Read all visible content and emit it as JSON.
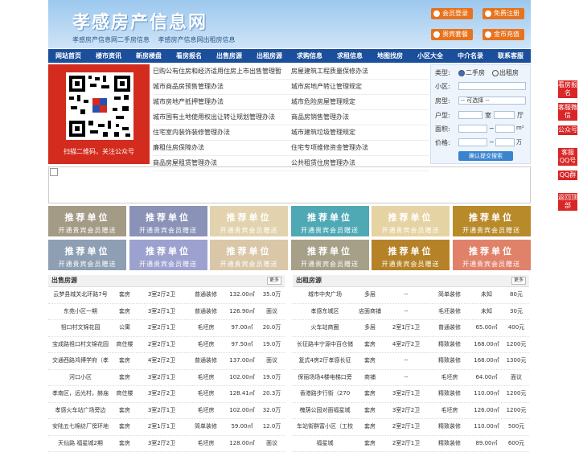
{
  "header": {
    "logo": "孝感房产信息网",
    "subtitle_1": "孝感房产信息网二手房信息",
    "subtitle_2": "孝感房产信息网出租房信息",
    "buttons": [
      "会员登录",
      "免费注册",
      "贵宾套餐",
      "金币充值"
    ]
  },
  "nav": [
    "网站首页",
    "楼市资讯",
    "新房楼盘",
    "看房报名",
    "出售房源",
    "出租房源",
    "求购信息",
    "求租信息",
    "地图找房",
    "小区大全",
    "中介名录",
    "联系客服"
  ],
  "qr": {
    "caption": "扫描二维码，关注公众号"
  },
  "links": [
    [
      "已购公有住房和经济适用住房上市出售管理暂",
      "房屋建筑工程质量保修办法"
    ],
    [
      "城市商品房预售管理办法",
      "城市房地产转让管理规定"
    ],
    [
      "城市房地产抵押管理办法",
      "城市危险房屋管理规定"
    ],
    [
      "城市国有土地使用权出让转让规划管理办法",
      "商品房销售管理办法"
    ],
    [
      "住宅室内装饰装修管理办法",
      "城市建筑垃圾管理规定"
    ],
    [
      "廉租住房保障办法",
      "住宅专项维修资金管理办法"
    ],
    [
      "商品房屋租赁管理办法",
      "公共租赁住房管理办法"
    ]
  ],
  "search": {
    "type_label": "类型:",
    "option_sale": "二手房",
    "option_rent": "出租房",
    "community_label": "小区:",
    "house_type_label": "房型:",
    "house_type_value": "-- 可选择 --",
    "layout_label": "户型:",
    "room_unit": "室",
    "hall_unit": "厅",
    "area_label": "面积:",
    "area_unit": "m²",
    "price_label": "价格:",
    "price_unit": "万",
    "range_sep": "~",
    "submit": "确认提交搜索"
  },
  "tiles": {
    "title": "推荐单位",
    "subtitle": "开通贵宾会员赠送"
  },
  "sale": {
    "title": "出售房源",
    "more": "更多",
    "rows": [
      [
        "云梦县城关北环路7号",
        "套房",
        "3室2厅2卫",
        "普通装修",
        "132.00㎡",
        "35.0万"
      ],
      [
        "东苑小区一期",
        "套房",
        "3室2厅1卫",
        "普通装修",
        "126.90㎡",
        "面议"
      ],
      [
        "祖口村文锦花园",
        "公寓",
        "2室2厅1卫",
        "毛坯房",
        "97.00㎡",
        "20.0万"
      ],
      [
        "宝成路祖口村文锦花园",
        "商住楼",
        "2室2厅1卫",
        "毛坯房",
        "97.50㎡",
        "19.0万"
      ],
      [
        "交通西路鸿博学府（孝",
        "套房",
        "4室2厅2卫",
        "普通装修",
        "137.00㎡",
        "面议"
      ],
      [
        "河口小区",
        "套房",
        "3室2厅1卫",
        "毛坯房",
        "102.00㎡",
        "19.0万"
      ],
      [
        "孝南区，远光村，赫庙",
        "商住楼",
        "3室2厅2卫",
        "毛坯房",
        "128.41㎡",
        "20.3万"
      ],
      [
        "孝感火车站广场旁边",
        "套房",
        "3室2厅1卫",
        "毛坯房",
        "102.00㎡",
        "32.0万"
      ],
      [
        "安陆五七棉纺厂傍环地",
        "套房",
        "2室1厅1卫",
        "简单装修",
        "59.00㎡",
        "12.0万"
      ],
      [
        "天仙路 福星城2期",
        "套房",
        "3室2厅2卫",
        "毛坯房",
        "128.00㎡",
        "面议"
      ]
    ]
  },
  "rent": {
    "title": "出租房源",
    "more": "更多",
    "rows": [
      [
        "城市中央广场",
        "多层",
        "--",
        "简单装修",
        "未知",
        "80元"
      ],
      [
        "孝感东城区",
        "店面商铺",
        "--",
        "毛坯装修",
        "未知",
        "30元"
      ],
      [
        "火车站商圈",
        "多层",
        "2室1厅1卫",
        "普通装修",
        "65.00㎡",
        "400元"
      ],
      [
        "长征路丰宁源中百仓储",
        "套房",
        "4室2厅2卫",
        "精致装修",
        "168.00㎡",
        "1200元"
      ],
      [
        "复式4房2厅孝感长征",
        "套房",
        "--",
        "精致装修",
        "168.00㎡",
        "1300元"
      ],
      [
        "保丽场场4楼电梯口旁",
        "商铺",
        "--",
        "毛坯房",
        "64.00㎡",
        "面议"
      ],
      [
        "香港路步行街（270",
        "套房",
        "3室2厅1卫",
        "精致装修",
        "110.00㎡",
        "1200元"
      ],
      [
        "槐荫公园对面福星城",
        "套房",
        "3室2厅2卫",
        "毛坯房",
        "126.00㎡",
        "1200元"
      ],
      [
        "车站街群富小区（工校",
        "套房",
        "2室2厅1卫",
        "精致装修",
        "110.00㎡",
        "500元"
      ],
      [
        "福星城",
        "套房",
        "2室2厅1卫",
        "精致装修",
        "89.00㎡",
        "600元"
      ]
    ]
  },
  "float": [
    "看房报名",
    "客服微信",
    "公众号",
    "客服QQ号",
    "QQ群",
    "返回顶部"
  ],
  "colors": {
    "nav": "#1b4f9c",
    "orange": "#e8731c",
    "red": "#d92626",
    "tiles": [
      "#a49b86",
      "#8a92b7",
      "#e2d3ae",
      "#4fa9b5",
      "#e6d3a3",
      "#b98a2a",
      "#8e9fb4",
      "#9da1cf",
      "#d9c7a8",
      "#a6a089",
      "#b58227",
      "#e0826a"
    ]
  }
}
